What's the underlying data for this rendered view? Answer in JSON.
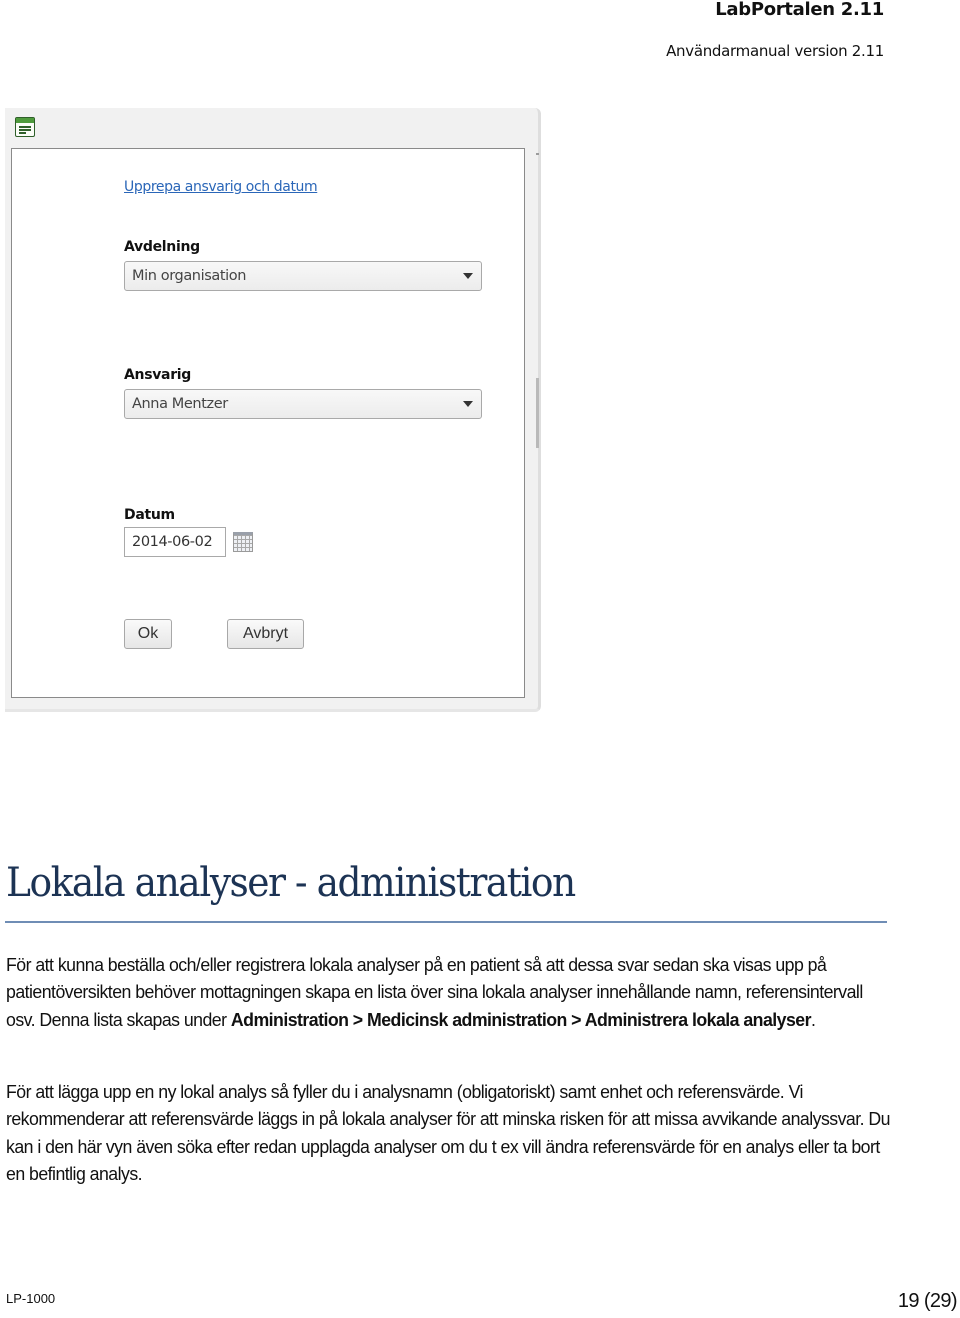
{
  "header": {
    "title": "LabPortalen 2.11",
    "subtitle": "Användarmanual version 2.11"
  },
  "screenshot": {
    "window_icon": "form-window-icon",
    "repeat_link": "Upprepa ansvarig och datum",
    "department": {
      "label": "Avdelning",
      "value": "Min organisation"
    },
    "responsible": {
      "label": "Ansvarig",
      "value": "Anna Mentzer"
    },
    "date": {
      "label": "Datum",
      "value": "2014-06-02",
      "icon": "calendar-icon"
    },
    "buttons": {
      "ok": "Ok",
      "cancel": "Avbryt"
    }
  },
  "section": {
    "heading": "Lokala analyser - administration",
    "para1": {
      "text": "För att kunna beställa och/eller registrera lokala analyser på en patient så att dessa svar sedan ska visas upp på patientöversikten behöver mottagningen skapa en lista över sina lokala analyser innehållande namn, referensintervall osv. Denna lista skapas under ",
      "bold": "Administration > Medicinsk administration > Administrera lokala analyser",
      "end": "."
    },
    "para2": "För att lägga upp en ny lokal analys så fyller du i analysnamn (obligatoriskt) samt enhet och referensvärde. Vi rekommenderar att referensvärde läggs in på lokala analyser för att minska risken för att missa avvikande analyssvar. Du kan i den här vyn även söka efter redan upplagda analyser om du t ex vill ändra referensvärde för en analys eller ta bort en befintlig analys."
  },
  "footer": {
    "doc_id": "LP-1000",
    "page": "19 (29)"
  }
}
